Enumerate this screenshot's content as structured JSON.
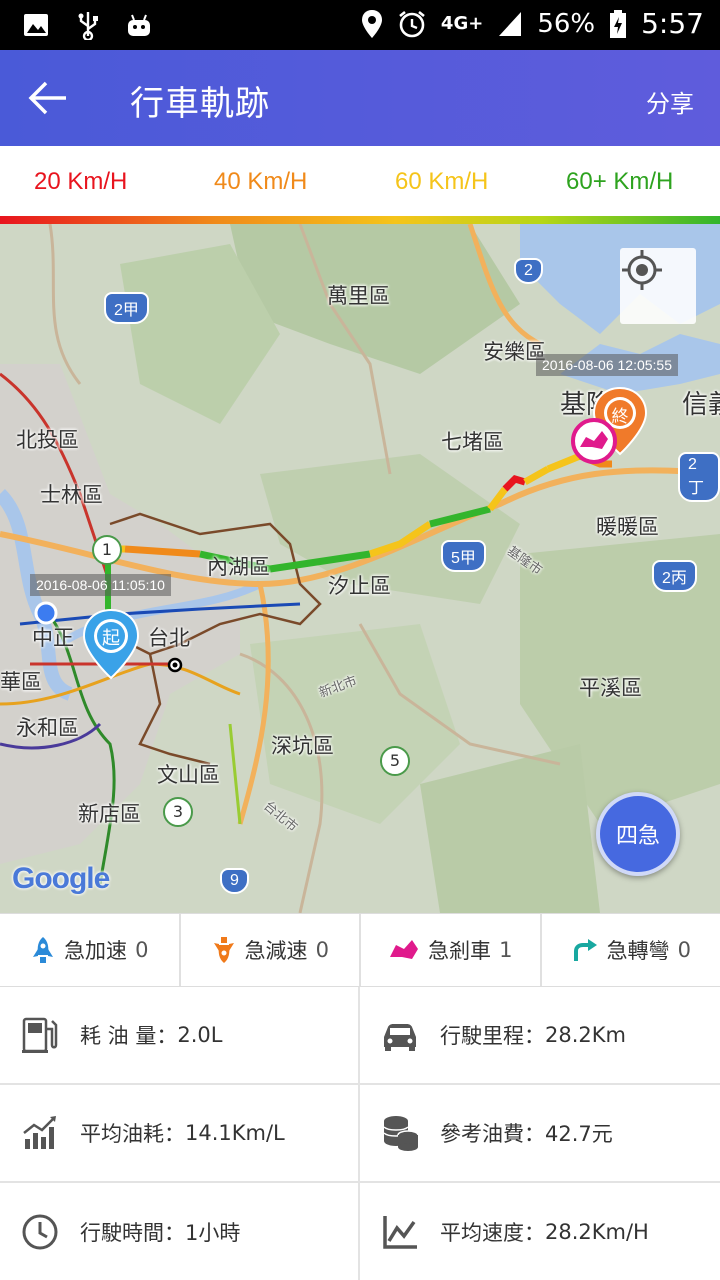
{
  "status_bar": {
    "network": "4G+",
    "battery": "56%",
    "time": "5:57"
  },
  "app_bar": {
    "title": "行車軌跡",
    "share_label": "分享"
  },
  "speed_legend": [
    {
      "label": "20 Km/H",
      "color": "#e8141e"
    },
    {
      "label": "40 Km/H",
      "color": "#f08a1a"
    },
    {
      "label": "60 Km/H",
      "color": "#f5c41a"
    },
    {
      "label": "60+ Km/H",
      "color": "#2ea31f"
    }
  ],
  "map": {
    "start_time": "2016-08-06 11:05:10",
    "end_time": "2016-08-06 12:05:55",
    "start_marker": "起",
    "end_marker": "終",
    "four_button": "四急",
    "labels": {
      "wanli": "萬里區",
      "anle": "安樂區",
      "keelung": "基隆市",
      "xinyi": "信義",
      "beitou": "北投區",
      "shilin": "士林區",
      "qidu": "七堵區",
      "nuannuan": "暖暖區",
      "neihu": "內湖區",
      "xizhi": "汐止區",
      "zhongzheng": "中正",
      "taipei": "台北",
      "wanhua": "華區",
      "yonghe": "永和區",
      "pingxi": "平溪區",
      "shenkeng": "深坑區",
      "wenshan": "文山區",
      "xindian": "新店區",
      "xinbei": "新北市",
      "keelung_road": "基隆市",
      "tpe_city": "台北市"
    },
    "shields": {
      "r2": "2",
      "r2jia": "2甲",
      "r2ding": "2丁",
      "r5jia": "5甲",
      "r2bing": "2丙",
      "r9": "9"
    },
    "flowers": {
      "f1": "1",
      "f3": "3",
      "f5": "5"
    },
    "google": "Google"
  },
  "events": [
    {
      "label": "急加速",
      "count": "0",
      "icon": "rocket-icon",
      "color": "#2b8ad8"
    },
    {
      "label": "急減速",
      "count": "0",
      "icon": "brake-icon",
      "color": "#f07a1a"
    },
    {
      "label": "急剎車",
      "count": "1",
      "icon": "car-crash-icon",
      "color": "#e01a8c"
    },
    {
      "label": "急轉彎",
      "count": "0",
      "icon": "turn-icon",
      "color": "#18a8a0"
    }
  ],
  "stats": {
    "fuel": {
      "label": "耗 油 量：",
      "value": "2.0L"
    },
    "distance": {
      "label": "行駛里程：",
      "value": "28.2Km"
    },
    "avg_consumption": {
      "label": "平均油耗：",
      "value": "14.1Km/L"
    },
    "cost": {
      "label": "參考油費：",
      "value": "42.7元"
    },
    "time": {
      "label": "行駛時間：",
      "value": "1小時"
    },
    "avg_speed": {
      "label": "平均速度：",
      "value": "28.2Km/H"
    }
  }
}
